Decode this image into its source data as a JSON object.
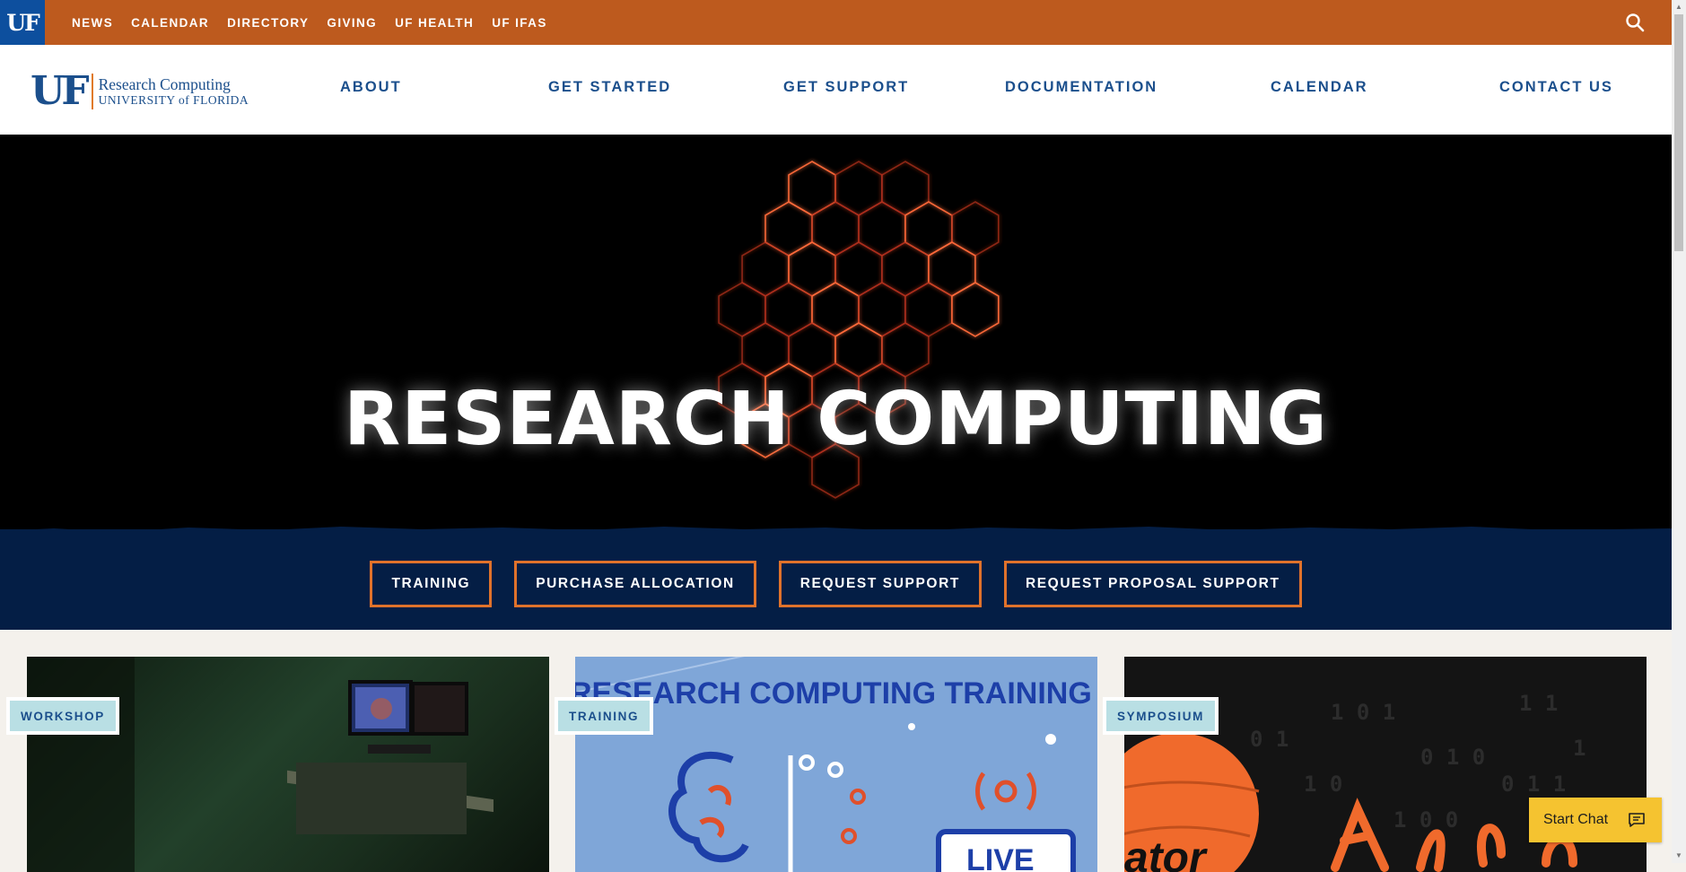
{
  "utility_bar": {
    "badge": "UF",
    "links": [
      "NEWS",
      "CALENDAR",
      "DIRECTORY",
      "GIVING",
      "UF HEALTH",
      "UF IFAS"
    ],
    "search_icon": "search-icon",
    "bg_color": "#bd5a1e"
  },
  "header": {
    "logo": {
      "mark": "UF",
      "line1": "Research Computing",
      "line2": "UNIVERSITY of FLORIDA"
    },
    "nav": [
      "ABOUT",
      "GET STARTED",
      "GET SUPPORT",
      "DOCUMENTATION",
      "CALENDAR",
      "CONTACT US"
    ]
  },
  "hero": {
    "title": "RESEARCH COMPUTING"
  },
  "cta": {
    "buttons": [
      "TRAINING",
      "PURCHASE ALLOCATION",
      "REQUEST SUPPORT",
      "REQUEST PROPOSAL SUPPORT"
    ],
    "border_color": "#e0722b",
    "bg_color": "#041e45"
  },
  "cards": [
    {
      "tag": "WORKSHOP"
    },
    {
      "tag": "TRAINING",
      "image_text": "RESEARCH COMPUTING TRAINING",
      "live_text": "LIVE"
    },
    {
      "tag": "SYMPOSIUM",
      "image_text": "ator"
    }
  ],
  "chat": {
    "label": "Start Chat",
    "icon": "chat-bubble-icon"
  }
}
